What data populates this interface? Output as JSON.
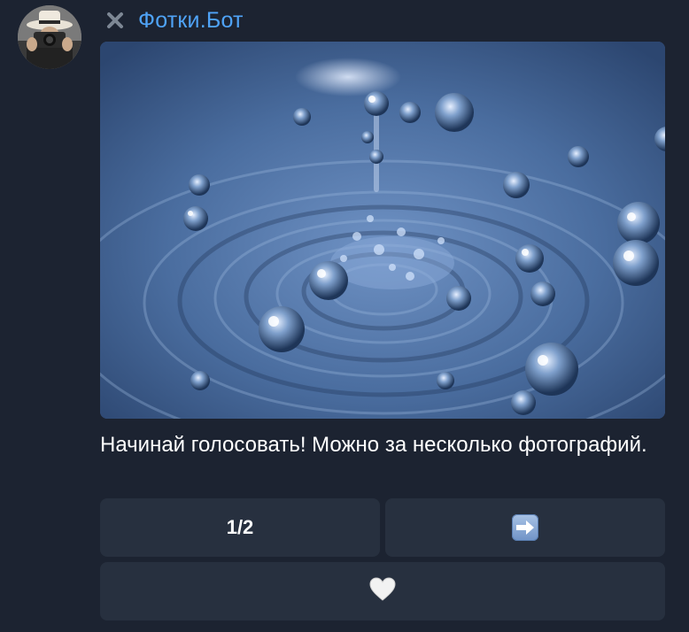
{
  "message": {
    "sender_name": "Фотки.Бот",
    "text": "Начинай голосовать! Можно за несколько фотографий.",
    "photo_icon": "water-droplet-photo"
  },
  "keyboard": {
    "page_label": "1/2",
    "next_icon": "right-arrow-emoji",
    "like_icon": "white-heart-emoji"
  },
  "colors": {
    "background": "#1c2331",
    "sender_name": "#4fa3f7",
    "button_bg": "#27303f",
    "text": "#ffffff"
  }
}
